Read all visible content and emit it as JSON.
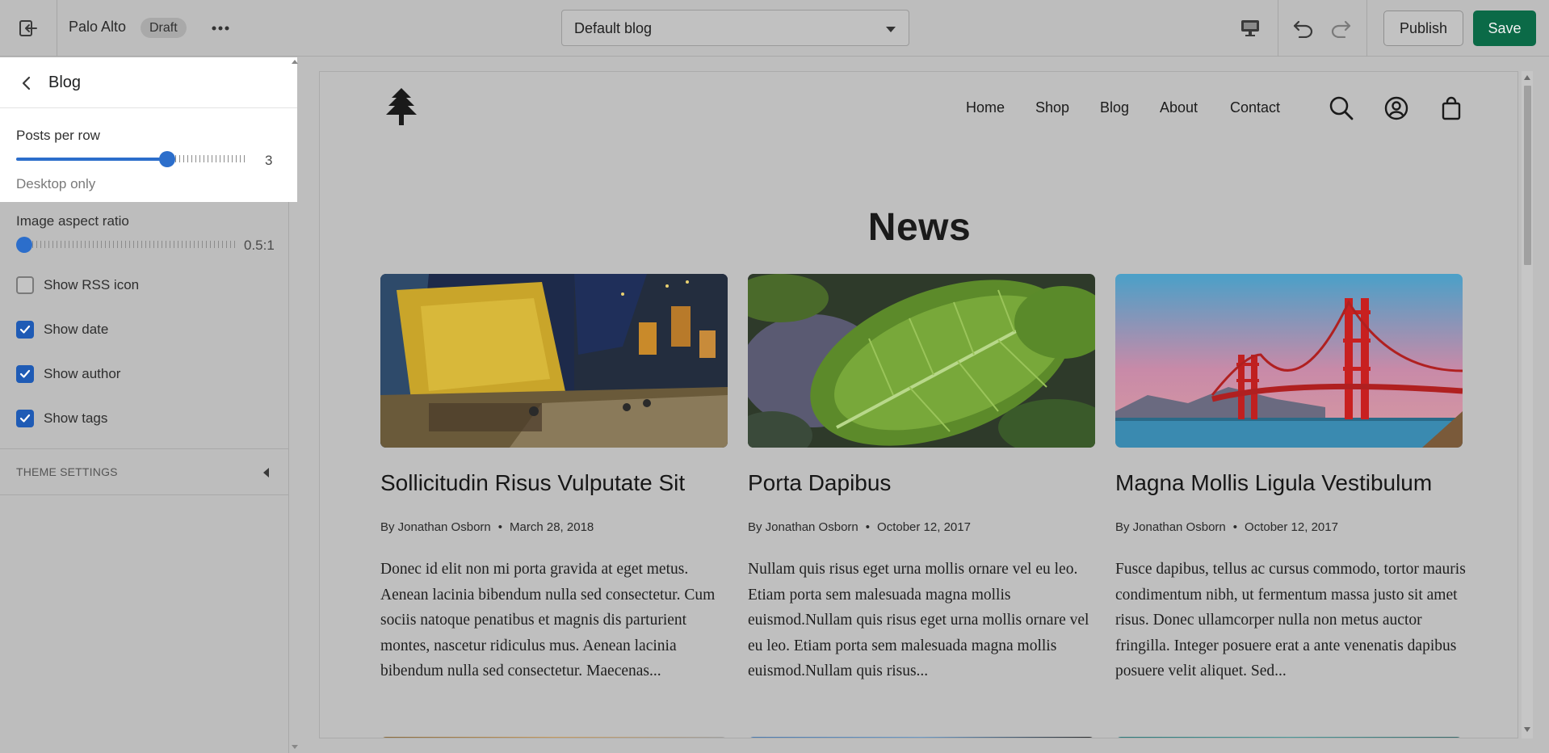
{
  "topbar": {
    "store_name": "Palo Alto",
    "draft_badge": "Draft",
    "template_select": {
      "value": "Default blog"
    },
    "publish_label": "Publish",
    "save_label": "Save",
    "icons": [
      "exit-icon",
      "more-icon",
      "desktop-icon",
      "undo-icon",
      "redo-icon"
    ]
  },
  "sidebar": {
    "title": "Blog",
    "posts_per_row": {
      "label": "Posts per row",
      "value": 3,
      "min": 1,
      "max": 4,
      "display": "3",
      "help": "Desktop only"
    },
    "image_aspect_ratio": {
      "label": "Image aspect ratio",
      "display": "0.5:1",
      "position": 0
    },
    "checkboxes": [
      {
        "label": "Show RSS icon",
        "checked": false
      },
      {
        "label": "Show date",
        "checked": true
      },
      {
        "label": "Show author",
        "checked": true
      },
      {
        "label": "Show tags",
        "checked": true
      }
    ],
    "theme_settings": "THEME SETTINGS"
  },
  "preview": {
    "nav": [
      "Home",
      "Shop",
      "Blog",
      "About",
      "Contact"
    ],
    "heading": "News",
    "posts": [
      {
        "title": "Sollicitudin Risus Vulputate Sit",
        "author": "By Jonathan Osborn",
        "date": "March 28, 2018",
        "excerpt": "Donec id elit non mi porta gravida at eget metus. Aenean lacinia bibendum nulla sed consectetur. Cum sociis natoque penatibus et magnis dis parturient montes, nascetur ridiculus mus. Aenean lacinia bibendum nulla sed consectetur. Maecenas..."
      },
      {
        "title": "Porta Dapibus",
        "author": "By Jonathan Osborn",
        "date": "October 12, 2017",
        "excerpt": "Nullam quis risus eget urna mollis ornare vel eu leo. Etiam porta sem malesuada magna mollis euismod.Nullam quis risus eget urna mollis ornare vel eu leo. Etiam porta sem malesuada magna mollis euismod.Nullam quis risus..."
      },
      {
        "title": "Magna Mollis Ligula Vestibulum",
        "author": "By Jonathan Osborn",
        "date": "October 12, 2017",
        "excerpt": "Fusce dapibus, tellus ac cursus commodo, tortor mauris condimentum nibh, ut fermentum massa justo sit amet risus. Donec ullamcorper nulla non metus auctor fringilla. Integer posuere erat a ante venenatis dapibus posuere velit aliquet. Sed..."
      }
    ]
  },
  "colors": {
    "accent": "#2c6ecb",
    "save": "#0b6a47",
    "checkbox": "#1f5bb5"
  }
}
